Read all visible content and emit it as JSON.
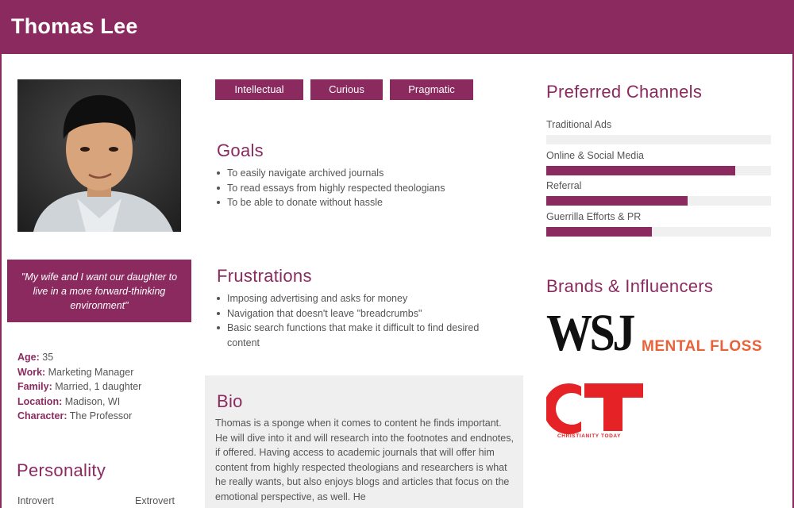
{
  "header": {
    "name": "Thomas Lee"
  },
  "quote": "\"My wife and I want our daughter to live in a more forward-thinking environment\"",
  "facts": [
    {
      "label": "Age:",
      "value": "35"
    },
    {
      "label": "Work:",
      "value": "Marketing Manager"
    },
    {
      "label": "Family:",
      "value": "Married, 1 daughter"
    },
    {
      "label": "Location:",
      "value": "Madison, WI"
    },
    {
      "label": "Character:",
      "value": "The Professor"
    }
  ],
  "personality": {
    "title": "Personality",
    "scale_left": "Introvert",
    "scale_right": "Extrovert"
  },
  "tags": [
    "Intellectual",
    "Curious",
    "Pragmatic"
  ],
  "goals": {
    "title": "Goals",
    "items": [
      "To easily navigate archived journals",
      "To read essays from highly respected theologians",
      "To be able to donate without hassle"
    ]
  },
  "frustrations": {
    "title": "Frustrations",
    "items": [
      "Imposing advertising and asks for money",
      "Navigation that doesn't leave \"breadcrumbs\"",
      "Basic search functions that make it difficult to find desired content"
    ]
  },
  "bio": {
    "title": "Bio",
    "text": "Thomas is a sponge when it comes to content he finds important. He will dive into it and will research into the footnotes and endnotes, if offered. Having access to academic journals that will offer him content from highly respected theologians and researchers is what he really wants, but also enjoys blogs and articles that focus on the emotional perspective, as well. He"
  },
  "channels": {
    "title": "Preferred Channels",
    "items": [
      {
        "label": "Traditional Ads",
        "level": 0
      },
      {
        "label": "Online & Social Media",
        "level": 0.84
      },
      {
        "label": "Referral",
        "level": 0.63
      },
      {
        "label": "Guerrilla Efforts & PR",
        "level": 0.47
      }
    ]
  },
  "brands": {
    "title": "Brands & Influencers",
    "wsj": "WSJ",
    "mental_floss": "MENTAL FLOSS",
    "ct": "CT",
    "ct_sub": "CHRISTIANITY TODAY"
  },
  "colors": {
    "accent": "#8a2a5f",
    "mental_floss": "#e8623a",
    "ct_red": "#e52326"
  }
}
